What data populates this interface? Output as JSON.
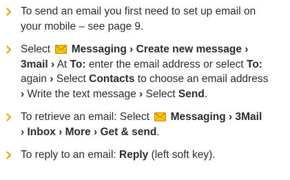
{
  "colors": {
    "bullet": "#f2a100",
    "text": "#2b2b2b",
    "icon_fill": "#f7c600",
    "icon_stroke": "#c98a00"
  },
  "icons": {
    "bullet": "chevron-right-icon",
    "messaging": "envelope-icon"
  },
  "items": [
    {
      "line1": "To send an email you first need to set up email on",
      "line2": "your mobile – see page 9."
    },
    {
      "select": "Select",
      "messaging": "Messaging",
      "sep": "›",
      "create_new": "Create new message",
      "mail": "3mail",
      "at": "At",
      "to": "To:",
      "enter_text": "enter the email address or select",
      "to_again": "To:",
      "again": "again",
      "select2": "Select",
      "contacts": "Contacts",
      "choose": "to choose an email address",
      "write": "Write the text message",
      "select3": "Select",
      "send": "Send",
      "period": "."
    },
    {
      "intro": "To retrieve an email: Select",
      "messaging": "Messaging",
      "sep": "›",
      "mail": "3Mail",
      "inbox": "Inbox",
      "more": "More",
      "get_send": "Get & send",
      "period": "."
    },
    {
      "intro": "To reply to an email:",
      "reply": "Reply",
      "suffix": "(left soft key)."
    }
  ]
}
